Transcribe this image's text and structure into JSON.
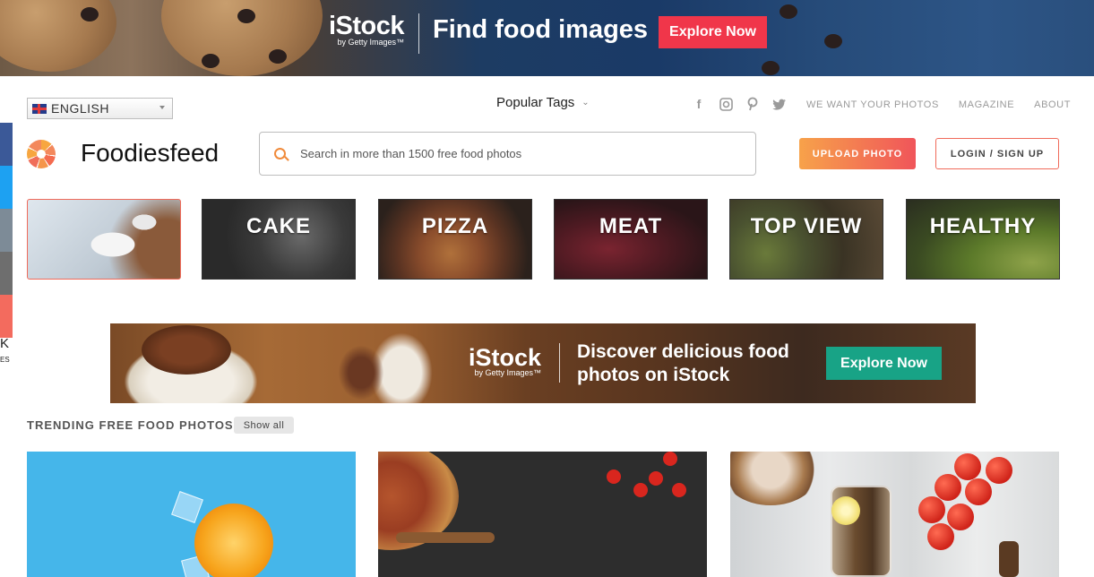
{
  "top_banner": {
    "brand": "iStock",
    "brand_sub": "by Getty Images™",
    "headline": "Find food images",
    "cta": "Explore Now"
  },
  "side_share": {
    "colors": [
      "#3b5998",
      "#1da1f2",
      "#7d8b97",
      "#6e6e6e",
      "#f36b5e"
    ],
    "partial_text_1": "K",
    "partial_text_2": "ES"
  },
  "header": {
    "language": "ENGLISH",
    "popular_tags": "Popular Tags",
    "social_icons": [
      "facebook-icon",
      "instagram-icon",
      "pinterest-icon",
      "twitter-icon"
    ],
    "links": [
      "WE WANT YOUR PHOTOS",
      "MAGAZINE",
      "ABOUT"
    ],
    "site_name": "Foodiesfeed",
    "search_placeholder": "Search in more than 1500 free food photos",
    "upload_button": "UPLOAD PHOTO",
    "login_button": "LOGIN / SIGN UP"
  },
  "categories": [
    {
      "label": "",
      "name": "coffee"
    },
    {
      "label": "CAKE",
      "name": "cake"
    },
    {
      "label": "PIZZA",
      "name": "pizza"
    },
    {
      "label": "MEAT",
      "name": "meat"
    },
    {
      "label": "TOP VIEW",
      "name": "top-view"
    },
    {
      "label": "HEALTHY",
      "name": "healthy"
    }
  ],
  "mid_banner": {
    "brand": "iStock",
    "brand_sub": "by Getty Images™",
    "headline_line1": "Discover delicious food",
    "headline_line2": "photos on iStock",
    "cta": "Explore Now"
  },
  "trending": {
    "title": "TRENDING FREE FOOD PHOTOS",
    "show_all": "Show all"
  },
  "colors": {
    "accent_orange": "#f08a3a",
    "cta_red": "#f0364a",
    "cta_green": "#18a386",
    "upload_gradient_start": "#f7a24a",
    "upload_gradient_end": "#f0555a"
  }
}
